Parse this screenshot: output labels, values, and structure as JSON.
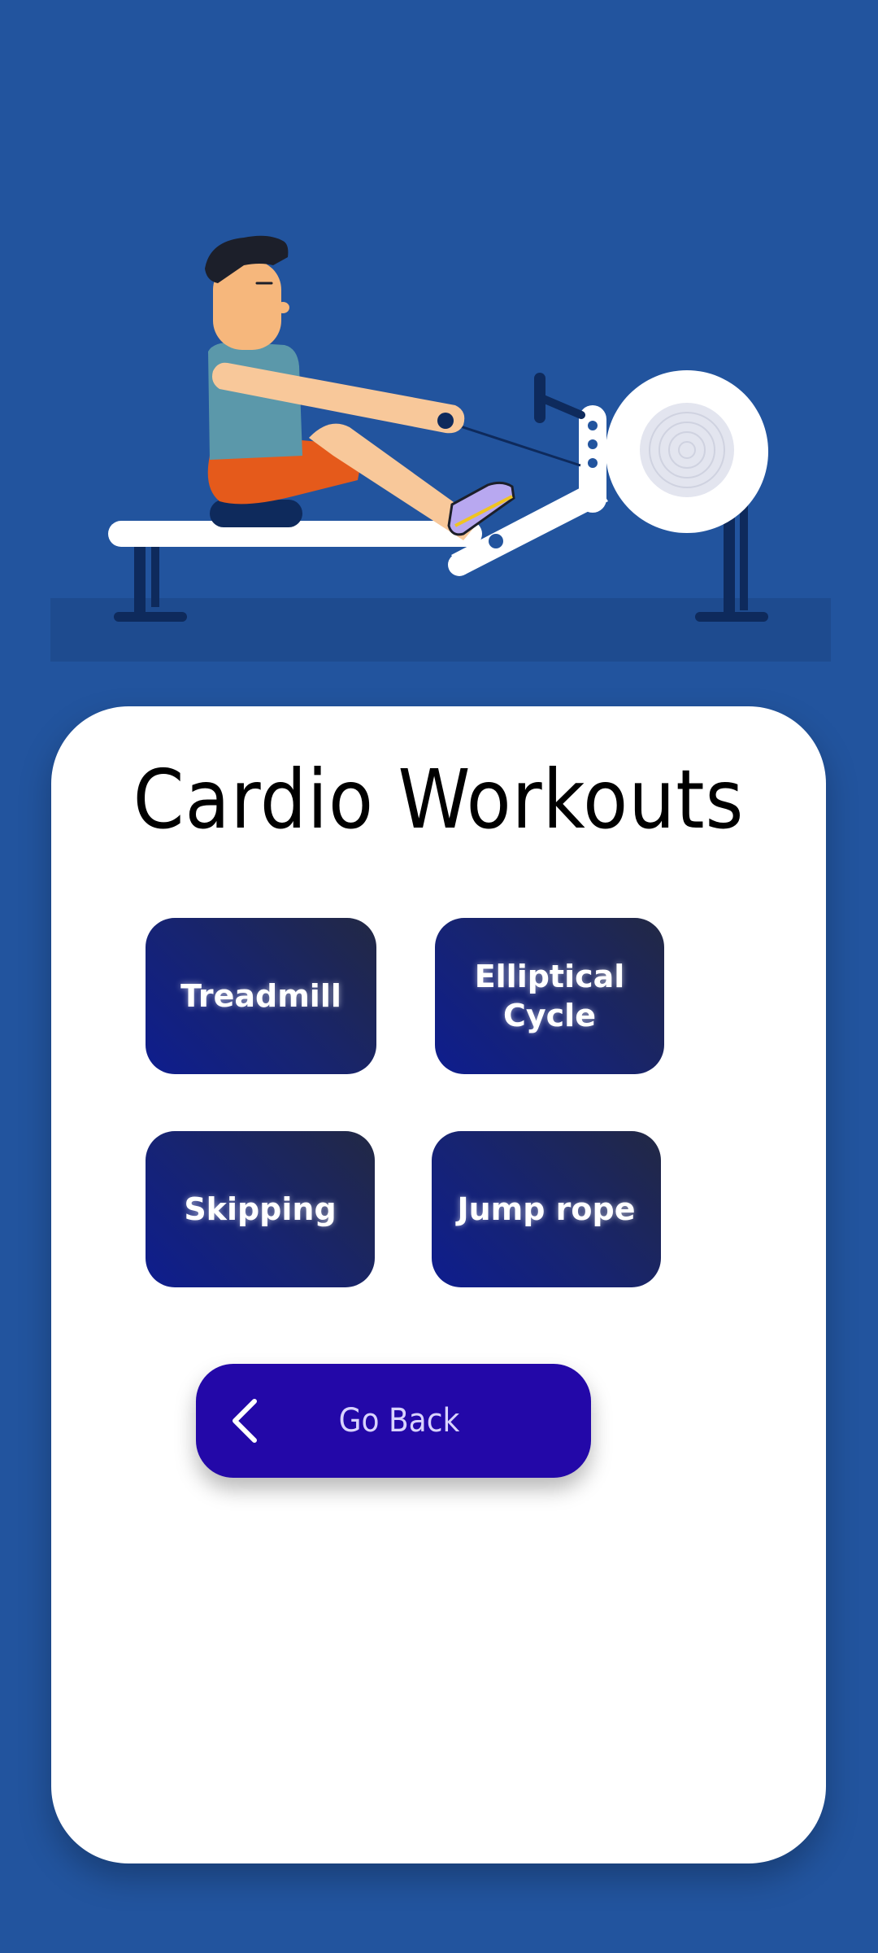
{
  "page": {
    "title": "Cardio Workouts"
  },
  "illustration": {
    "subject": "rowing-machine-illustration"
  },
  "workouts": [
    {
      "label": "Treadmill"
    },
    {
      "label": "Elliptical Cycle"
    },
    {
      "label": "Skipping"
    },
    {
      "label": "Jump rope"
    }
  ],
  "back_button": {
    "label": "Go Back",
    "icon": "chevron-left-icon"
  },
  "colors": {
    "background": "#22549e",
    "card": "#ffffff",
    "tile_gradient_start": "#0e1d8e",
    "tile_gradient_end": "#222844",
    "back_button": "#2308a8",
    "back_button_text": "#d9d3ff"
  }
}
